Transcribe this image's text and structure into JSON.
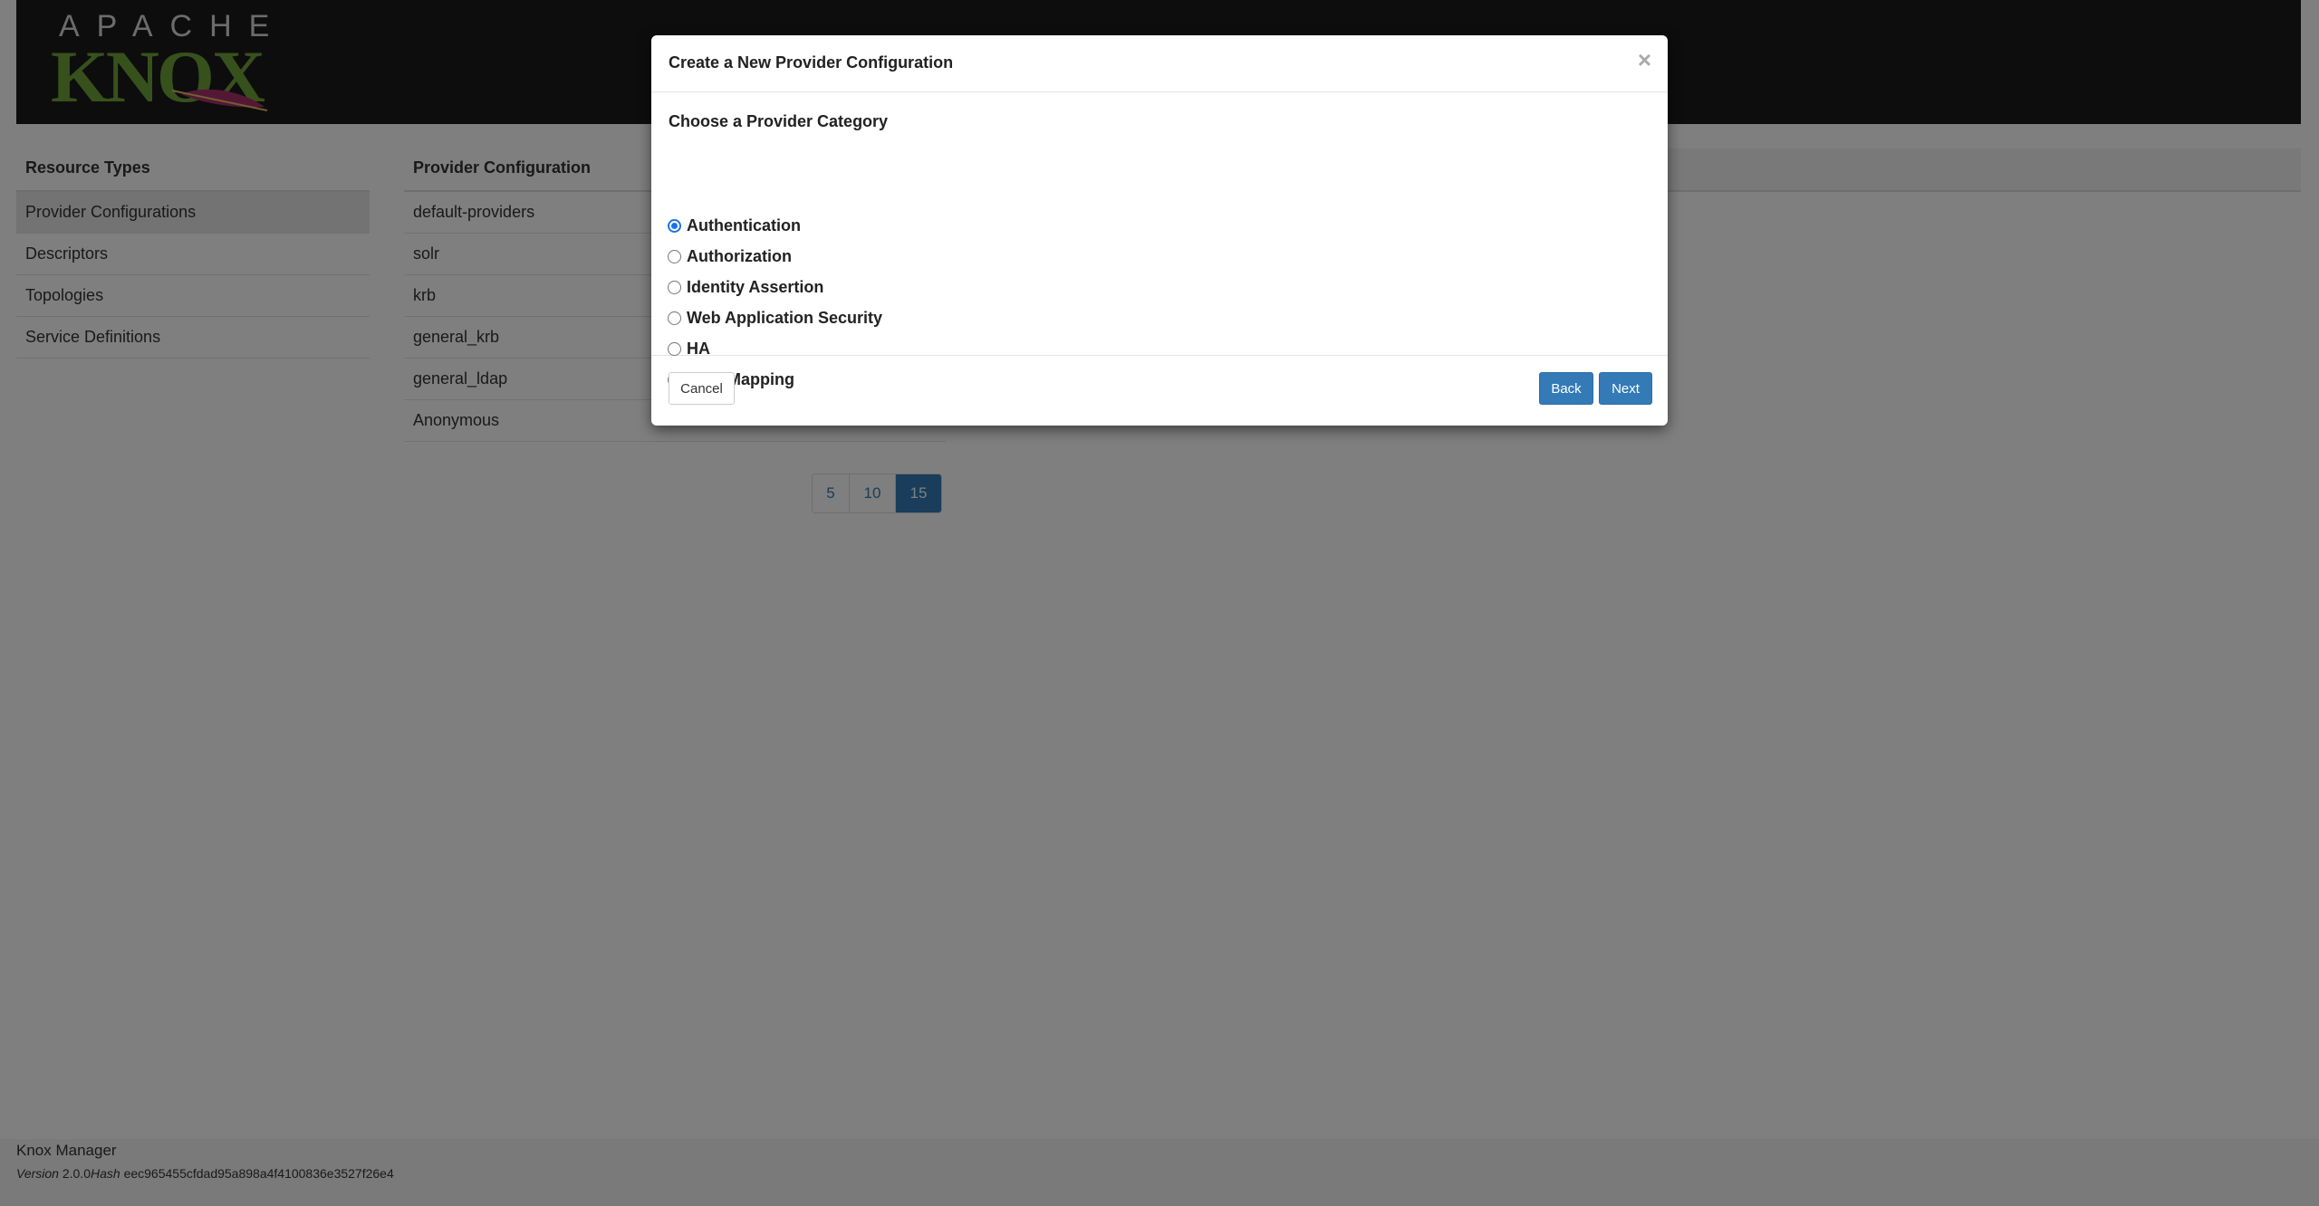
{
  "header": {
    "logo_top": "APACHE",
    "logo_main": "KNOX"
  },
  "resource_types": {
    "heading": "Resource Types",
    "items": [
      {
        "label": "Provider Configurations",
        "active": true
      },
      {
        "label": "Descriptors"
      },
      {
        "label": "Topologies"
      },
      {
        "label": "Service Definitions"
      }
    ]
  },
  "provider_configs": {
    "heading": "Provider Configuration",
    "items": [
      "default-providers",
      "solr",
      "krb",
      "general_krb",
      "general_ldap",
      "Anonymous"
    ],
    "pagination": [
      "5",
      "10",
      "15"
    ],
    "selected_page_size": "15"
  },
  "footer": {
    "title": "Knox Manager",
    "version_label": "Version",
    "version": "2.0.0",
    "hash_label": "Hash",
    "hash": "eec965455cfdad95a898a4f4100836e3527f26e4"
  },
  "modal": {
    "title": "Create a New Provider Configuration",
    "close_glyph": "×",
    "prompt": "Choose a Provider Category",
    "options": [
      "Authentication",
      "Authorization",
      "Identity Assertion",
      "Web Application Security",
      "HA",
      "Host Mapping"
    ],
    "selected_option": "Authentication",
    "cancel_label": "Cancel",
    "back_label": "Back",
    "next_label": "Next"
  },
  "colors": {
    "header_bg": "#1b1b1b",
    "logo_green": "#6ea23a",
    "primary": "#337ab7",
    "feather": "#a8306b"
  }
}
